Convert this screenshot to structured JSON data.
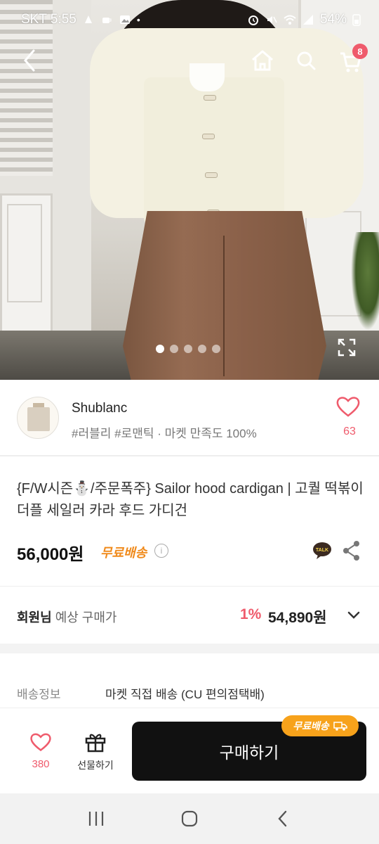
{
  "status_bar": {
    "carrier_time": "SKT 5:55",
    "battery": "54%"
  },
  "hero": {
    "cart_count": "8",
    "slides": {
      "count": 5,
      "active_index": 0
    }
  },
  "shop": {
    "name": "Shublanc",
    "tags": "#러블리 #로맨틱 · 마켓 만족도 100%",
    "like_count": "63"
  },
  "product": {
    "title": "{F/W시즌⛄/주문폭주} Sailor hood cardigan | 고퀄 떡볶이 더플 세일러 카라 후드 가디건",
    "price": "56,000원",
    "free_shipping": "무료배송",
    "talk_label": "TALK"
  },
  "member": {
    "label_bold": "회원님",
    "label_rest": " 예상 구매가",
    "discount": "1%",
    "price": "54,890원"
  },
  "shipping": {
    "label": "배송정보",
    "value": "마켓 직접 배송 (CU 편의점택배)"
  },
  "bottom_bar": {
    "like_count": "380",
    "gift_label": "선물하기",
    "buy_label": "구매하기",
    "ship_pill": "무료배송"
  },
  "colors": {
    "accent_pink": "#ef5b6c",
    "free_ship_orange": "#f08a1b",
    "buy_button": "#111111"
  }
}
